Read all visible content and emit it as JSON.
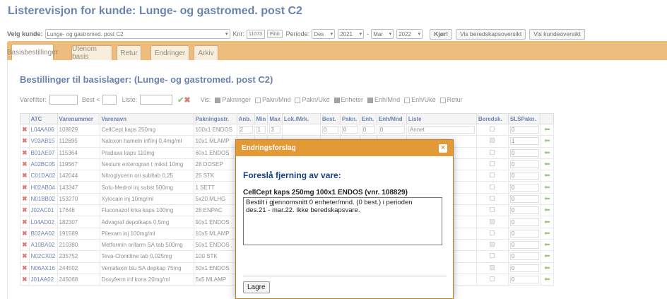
{
  "title": "Listerevisjon for kunde: Lunge- og gastromed. post C2",
  "controls": {
    "velg_kunde_label": "Velg kunde:",
    "kunde_value": "Lunge- og gastromed. post C2",
    "knr_label": "Knr:",
    "knr_value": "11073",
    "finn_label": "Finn",
    "periode_label": "Periode:",
    "from_month": "Des",
    "from_year": "2021",
    "dash": "-",
    "to_month": "Mar",
    "to_year": "2022",
    "kjor_label": "Kjør!",
    "beredskap_btn": "Vis beredskapsoversikt",
    "kunde_btn": "Vis kundeoversikt"
  },
  "tabs": [
    "Basisbestillinger",
    "Utenom basis",
    "Retur",
    "Endringer",
    "Arkiv"
  ],
  "subtitle": "Bestillinger til basislager:  (Lunge- og gastromed. post C2)",
  "filters": {
    "varefilter": "Varefilter:",
    "best": "Best <",
    "liste": "Liste:",
    "vis": "Vis:",
    "options": [
      {
        "label": "Pakninger",
        "checked": true
      },
      {
        "label": "Pakn/Mnd",
        "checked": false
      },
      {
        "label": "Pakn/Uke",
        "checked": false
      },
      {
        "label": "Enheter",
        "checked": true
      },
      {
        "label": "Enh/Mnd",
        "checked": true
      },
      {
        "label": "Enh/Uke",
        "checked": false
      },
      {
        "label": "Retur",
        "checked": false
      }
    ]
  },
  "table": {
    "headers": [
      "",
      "ATC",
      "Varenummer",
      "Varenavn",
      "Pakningsstr.",
      "Anb.",
      "Min",
      "Max",
      "Lok./Mrk.",
      "Best.",
      "Pakn.",
      "Enh.",
      "Enh/Mnd",
      "Liste",
      "Beredsk.",
      "SLSPakn.",
      ""
    ],
    "rows": [
      {
        "atc": "L04AA06",
        "varenr": "108829",
        "navn": "CellCept kaps 250mg",
        "pakn": "100x1 ENDOS",
        "anb": "2",
        "min": "1",
        "max": "3",
        "best": "0",
        "pakn_n": "0",
        "enh": "0",
        "enhmnd": "0",
        "liste": "Annet",
        "beredsk": false,
        "sls": "0"
      },
      {
        "atc": "V03AB15",
        "varenr": "112695",
        "navn": "Naloxon hameln inf/inj 0,4mg/ml",
        "pakn": "10x1 MLAMP",
        "anb": "",
        "min": "",
        "max": "",
        "best": "",
        "pakn_n": "",
        "enh": "",
        "enhmnd": "",
        "liste": "",
        "beredsk": true,
        "sls": "1"
      },
      {
        "atc": "B01AE07",
        "varenr": "115364",
        "navn": "Pradaxa kaps 110mg",
        "pakn": "60x1 ENDOS",
        "anb": "",
        "min": "",
        "max": "",
        "best": "",
        "pakn_n": "",
        "enh": "",
        "enhmnd": "",
        "liste": "",
        "beredsk": false,
        "sls": "0"
      },
      {
        "atc": "A02BC05",
        "varenr": "119567",
        "navn": "Nexium enterogran t mikst 10mg",
        "pakn": "28 DOSEP",
        "anb": "",
        "min": "",
        "max": "",
        "best": "",
        "pakn_n": "",
        "enh": "",
        "enhmnd": "",
        "liste": "",
        "beredsk": false,
        "sls": "0"
      },
      {
        "atc": "C01DA02",
        "varenr": "142044",
        "navn": "Nitroglycerin ori subltab 0,25",
        "pakn": "25 STK",
        "anb": "",
        "min": "",
        "max": "",
        "best": "",
        "pakn_n": "",
        "enh": "",
        "enhmnd": "",
        "liste": "",
        "beredsk": false,
        "sls": "0"
      },
      {
        "atc": "H02AB04",
        "varenr": "143347",
        "navn": "Solu-Medrol inj subst 500mg",
        "pakn": "1 SETT",
        "anb": "",
        "min": "",
        "max": "",
        "best": "",
        "pakn_n": "",
        "enh": "",
        "enhmnd": "",
        "liste": "",
        "beredsk": false,
        "sls": "0"
      },
      {
        "atc": "N01BB02",
        "varenr": "153270",
        "navn": "Xylocain inj 10mg/ml",
        "pakn": "5x20 MLHG",
        "anb": "",
        "min": "",
        "max": "",
        "best": "",
        "pakn_n": "",
        "enh": "",
        "enhmnd": "",
        "liste": "",
        "beredsk": false,
        "sls": "0"
      },
      {
        "atc": "J02AC01",
        "varenr": "17646",
        "navn": "Fluconazol krka kaps 100mg",
        "pakn": "28 ENPAC",
        "anb": "",
        "min": "",
        "max": "",
        "best": "",
        "pakn_n": "",
        "enh": "",
        "enhmnd": "",
        "liste": "",
        "beredsk": false,
        "sls": "0"
      },
      {
        "atc": "L04AD02",
        "varenr": "182307",
        "navn": "Advagraf depotkaps 0,5mg",
        "pakn": "50x1 ENDOS",
        "anb": "",
        "min": "",
        "max": "",
        "best": "",
        "pakn_n": "",
        "enh": "",
        "enhmnd": "",
        "liste": "",
        "beredsk": true,
        "sls": "0"
      },
      {
        "atc": "B02AA02",
        "varenr": "191589",
        "navn": "Pilexam inj 100mg/ml",
        "pakn": "10x5 MLAMP",
        "anb": "",
        "min": "",
        "max": "",
        "best": "",
        "pakn_n": "",
        "enh": "",
        "enhmnd": "",
        "liste": "",
        "beredsk": false,
        "sls": "0"
      },
      {
        "atc": "A10BA02",
        "varenr": "210380",
        "navn": "Metformin orifarm SA tab 500mg",
        "pakn": "50x1 ENDOS",
        "anb": "",
        "min": "",
        "max": "",
        "best": "",
        "pakn_n": "",
        "enh": "",
        "enhmnd": "",
        "liste": "",
        "beredsk": true,
        "sls": "0"
      },
      {
        "atc": "N02CX02",
        "varenr": "235752",
        "navn": "Teva-Clonidine tab 0,025mg",
        "pakn": "100 STK",
        "anb": "",
        "min": "",
        "max": "",
        "best": "",
        "pakn_n": "",
        "enh": "",
        "enhmnd": "",
        "liste": "",
        "beredsk": false,
        "sls": "0"
      },
      {
        "atc": "N06AX16",
        "varenr": "244502",
        "navn": "Venlafaxin blu SA depkap 75mg",
        "pakn": "50x1 ENDOS",
        "anb": "",
        "min": "",
        "max": "",
        "best": "",
        "pakn_n": "",
        "enh": "",
        "enhmnd": "",
        "liste": "",
        "beredsk": true,
        "sls": "0"
      },
      {
        "atc": "J01AA02",
        "varenr": "245068",
        "navn": "Doxyferm inf kons 20mg/ml",
        "pakn": "5x5 MLAMP",
        "anb": "",
        "min": "",
        "max": "",
        "best": "",
        "pakn_n": "",
        "enh": "",
        "enhmnd": "",
        "liste": "",
        "beredsk": false,
        "sls": "0"
      }
    ]
  },
  "dialog": {
    "header": "Endringsforslag",
    "close": "×",
    "title": "Foreslå fjerning av vare:",
    "product": "CellCept kaps 250mg 100x1 ENDOS (vnr. 108829)",
    "text": "Bestilt i gjennomsnitt 0 enheter/mnd. (0 best.) i perioden\ndes.21 - mar.22. Ikke beredskapsvare.",
    "save": "Lagre"
  },
  "icons": {
    "delete": "✖",
    "ok": "✔",
    "arrow": "⬅",
    "caret": "▾"
  },
  "colors": {
    "accent": "#e29a37",
    "title": "#1b3f86",
    "delete": "#c0392b",
    "ok": "#5fa53a"
  }
}
